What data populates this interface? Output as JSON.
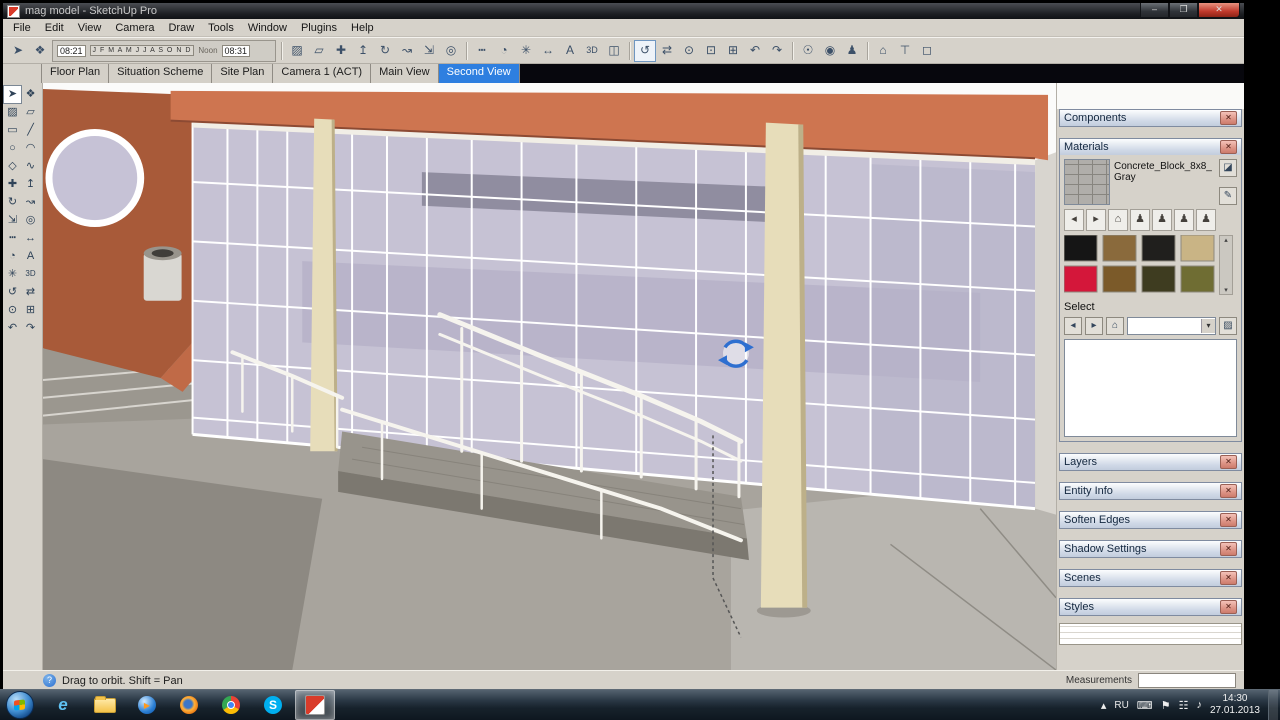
{
  "window": {
    "title": "mag model - SketchUp Pro",
    "controls": {
      "minimize": "–",
      "maximize": "❐",
      "close": "✕"
    }
  },
  "menu_bar": {
    "items": [
      "File",
      "Edit",
      "View",
      "Camera",
      "Draw",
      "Tools",
      "Window",
      "Plugins",
      "Help"
    ]
  },
  "top_toolbar": {
    "shadow": {
      "months": "J F M A M J J A S O N D",
      "left_value": "08:21",
      "noon_label": "Noon",
      "right_value": "08:31"
    },
    "icons": [
      {
        "name": "select-tool-icon",
        "glyph": "➤"
      },
      {
        "name": "make-component-icon",
        "glyph": "❖"
      },
      {
        "name": "paint-bucket-icon",
        "glyph": "▨"
      },
      {
        "name": "eraser-tool-icon",
        "glyph": "▱"
      },
      {
        "name": "move-tool-icon",
        "glyph": "✚"
      },
      {
        "name": "push-pull-icon",
        "glyph": "↥"
      },
      {
        "name": "rotate-tool-icon",
        "glyph": "↻"
      },
      {
        "name": "follow-me-icon",
        "glyph": "↝"
      },
      {
        "name": "scale-tool-icon",
        "glyph": "⇲"
      },
      {
        "name": "offset-tool-icon",
        "glyph": "◎"
      },
      {
        "name": "tape-measure-icon",
        "glyph": "┅"
      },
      {
        "name": "protractor-icon",
        "glyph": "◔"
      },
      {
        "name": "axes-tool-icon",
        "glyph": "✳"
      },
      {
        "name": "dimension-tool-icon",
        "glyph": "↔"
      },
      {
        "name": "text-tool-icon",
        "glyph": "A"
      },
      {
        "name": "3d-text-icon",
        "glyph": "3D"
      },
      {
        "name": "section-plane-icon",
        "glyph": "◫"
      },
      {
        "name": "orbit-tool-icon",
        "glyph": "↺"
      },
      {
        "name": "pan-tool-icon",
        "glyph": "⇄"
      },
      {
        "name": "zoom-tool-icon",
        "glyph": "⊙"
      },
      {
        "name": "zoom-window-icon",
        "glyph": "⊡"
      },
      {
        "name": "zoom-extents-icon",
        "glyph": "⊞"
      },
      {
        "name": "previous-view-icon",
        "glyph": "↶"
      },
      {
        "name": "next-view-icon",
        "glyph": "↷"
      },
      {
        "name": "position-camera-icon",
        "glyph": "☉"
      },
      {
        "name": "look-around-icon",
        "glyph": "◉"
      },
      {
        "name": "walk-tool-icon",
        "glyph": "♟"
      },
      {
        "name": "iso-view-icon",
        "glyph": "⌂"
      },
      {
        "name": "top-view-icon",
        "glyph": "⊤"
      },
      {
        "name": "front-view-icon",
        "glyph": "◻"
      }
    ]
  },
  "scene_tabs": {
    "tabs": [
      {
        "label": "Floor Plan",
        "active": false
      },
      {
        "label": "Situation Scheme",
        "active": false
      },
      {
        "label": "Site Plan",
        "active": false
      },
      {
        "label": "Camera 1 (ACT)",
        "active": false
      },
      {
        "label": "Main View",
        "active": false
      },
      {
        "label": "Second View",
        "active": true
      }
    ]
  },
  "left_toolbar": {
    "icons": [
      {
        "name": "select-tool-icon",
        "glyph": "➤"
      },
      {
        "name": "make-component-icon",
        "glyph": "❖"
      },
      {
        "name": "paint-bucket-icon",
        "glyph": "▨"
      },
      {
        "name": "eraser-tool-icon",
        "glyph": "▱"
      },
      {
        "name": "rectangle-tool-icon",
        "glyph": "▭"
      },
      {
        "name": "line-tool-icon",
        "glyph": "╱"
      },
      {
        "name": "circle-tool-icon",
        "glyph": "○"
      },
      {
        "name": "arc-tool-icon",
        "glyph": "◠"
      },
      {
        "name": "polygon-tool-icon",
        "glyph": "◇"
      },
      {
        "name": "freehand-tool-icon",
        "glyph": "∿"
      },
      {
        "name": "move-tool-icon",
        "glyph": "✚"
      },
      {
        "name": "push-pull-icon",
        "glyph": "↥"
      },
      {
        "name": "rotate-tool-icon",
        "glyph": "↻"
      },
      {
        "name": "follow-me-icon",
        "glyph": "↝"
      },
      {
        "name": "scale-tool-icon",
        "glyph": "⇲"
      },
      {
        "name": "offset-tool-icon",
        "glyph": "◎"
      },
      {
        "name": "tape-measure-icon",
        "glyph": "┅"
      },
      {
        "name": "dimension-tool-icon",
        "glyph": "↔"
      },
      {
        "name": "protractor-icon",
        "glyph": "◔"
      },
      {
        "name": "text-tool-icon",
        "glyph": "A"
      },
      {
        "name": "axes-tool-icon",
        "glyph": "✳"
      },
      {
        "name": "3d-text-icon",
        "glyph": "3D"
      },
      {
        "name": "orbit-tool-icon",
        "glyph": "↺"
      },
      {
        "name": "pan-tool-icon",
        "glyph": "⇄"
      },
      {
        "name": "zoom-tool-icon",
        "glyph": "⊙"
      },
      {
        "name": "zoom-extents-icon",
        "glyph": "⊞"
      },
      {
        "name": "previous-view-icon",
        "glyph": "↶"
      },
      {
        "name": "next-view-icon",
        "glyph": "↷"
      }
    ]
  },
  "right_tray": {
    "close_glyph": "✕",
    "components": {
      "title": "Components"
    },
    "materials": {
      "title": "Materials",
      "material_name": "Concrete_Block_8x8_Gray",
      "buttons": {
        "secondary_pane": "◪",
        "eyedropper": "✎"
      },
      "browser_thumbs": [
        {
          "name": "back-arrow-icon",
          "glyph": "◂"
        },
        {
          "name": "forward-arrow-icon",
          "glyph": "▸"
        },
        {
          "name": "in-model-icon",
          "glyph": "⌂"
        },
        {
          "name": "component-thumb",
          "glyph": "♟"
        },
        {
          "name": "component-thumb",
          "glyph": "♟"
        },
        {
          "name": "component-thumb",
          "glyph": "♟"
        },
        {
          "name": "component-thumb",
          "glyph": "♟"
        }
      ],
      "swatches": [
        "#151515",
        "#8a6a3c",
        "#201f1d",
        "#c9b485",
        "#d4173a",
        "#7b5a29",
        "#3e3c20",
        "#6f6d33"
      ],
      "scrollbar": {
        "up": "▴",
        "down": "▾"
      },
      "select_label": "Select",
      "select_row": {
        "back": "◂",
        "forward": "▸",
        "home": "⌂",
        "dropdown_arrow": "▾",
        "sample_paint": "▨"
      }
    },
    "collapsed_panels": [
      "Layers",
      "Entity Info",
      "Soften Edges",
      "Shadow Settings",
      "Scenes",
      "Styles"
    ]
  },
  "status_bar": {
    "help_glyph": "?",
    "hint": "Drag to orbit.  Shift = Pan",
    "measurements_label": "Measurements"
  },
  "taskbar": {
    "apps": [
      {
        "name": "internet-explorer",
        "glyph": "e"
      },
      {
        "name": "windows-explorer",
        "glyph": ""
      },
      {
        "name": "media-player",
        "glyph": "▶"
      },
      {
        "name": "firefox",
        "glyph": ""
      },
      {
        "name": "chrome",
        "glyph": ""
      },
      {
        "name": "skype",
        "glyph": "S"
      },
      {
        "name": "sketchup",
        "glyph": "",
        "active": true
      }
    ],
    "tray": {
      "hidden_icons": "▴",
      "language": "RU",
      "keyboard": "⌨",
      "action_center": "⚑",
      "network": "☷",
      "volume": "♪",
      "time": "14:30",
      "date": "27.01.2013"
    }
  },
  "viewport_colors": {
    "sky": "#fbfbfa",
    "ground": "#a8a49d",
    "ground_dark": "#8d8982",
    "ground_light": "#b9b6b0",
    "steps": "#9b978f",
    "wall": "#a85a39",
    "window_glass": "#c6c2d6",
    "glass": "#c6c2d4",
    "glass_shade": "#b6b2c8",
    "interior": "#908da0",
    "fascia": "#ce7550",
    "fascia_edge": "#8c4a33",
    "beam": "#f1eee6",
    "column": "#e7ddba",
    "column_edge": "#bdb089",
    "side_wall": "#d8d5cf",
    "ramp": "#98948c",
    "ramp_side": "#7c7870",
    "railing": "#f6f4ee",
    "mullion": "#ffffff",
    "dashed": "#555555",
    "cursor": "#2e6fd0",
    "can_body": "#d9d7d2",
    "can_rim": "#98948c",
    "can_hole": "#403e3a"
  }
}
